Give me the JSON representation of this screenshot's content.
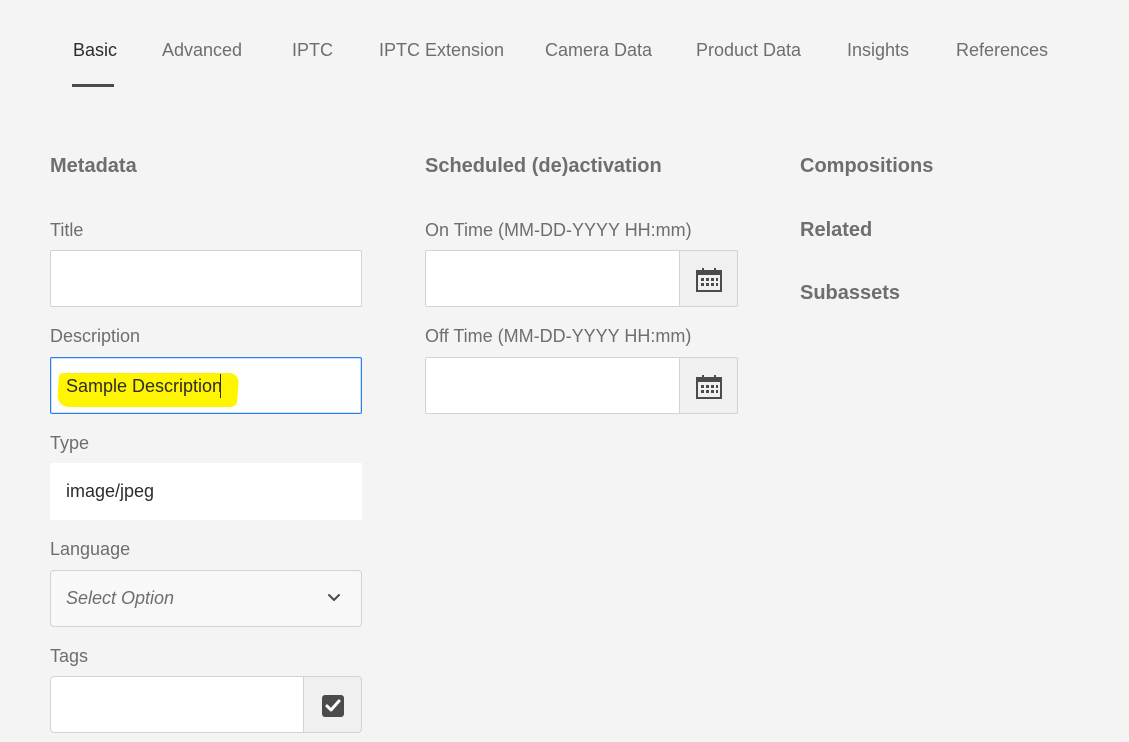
{
  "tabs": [
    {
      "label": "Basic",
      "active": true
    },
    {
      "label": "Advanced"
    },
    {
      "label": "IPTC"
    },
    {
      "label": "IPTC Extension"
    },
    {
      "label": "Camera Data"
    },
    {
      "label": "Product Data"
    },
    {
      "label": "Insights"
    },
    {
      "label": "References"
    }
  ],
  "metadata": {
    "heading": "Metadata",
    "title_label": "Title",
    "title_value": "",
    "description_label": "Description",
    "description_value": "Sample Description",
    "type_label": "Type",
    "type_value": "image/jpeg",
    "language_label": "Language",
    "language_placeholder": "Select Option",
    "tags_label": "Tags",
    "tags_value": ""
  },
  "scheduling": {
    "heading": "Scheduled (de)activation",
    "on_time_label": "On Time (MM-DD-YYYY HH:mm)",
    "on_time_value": "",
    "off_time_label": "Off Time (MM-DD-YYYY HH:mm)",
    "off_time_value": ""
  },
  "related_links": {
    "compositions": "Compositions",
    "related": "Related",
    "subassets": "Subassets"
  },
  "icons": {
    "calendar": "calendar-icon",
    "chevron": "chevron-down-icon",
    "checkbox": "checkbox-checked-icon"
  },
  "colors": {
    "focus_border": "#2680eb",
    "highlight": "#fff500"
  }
}
